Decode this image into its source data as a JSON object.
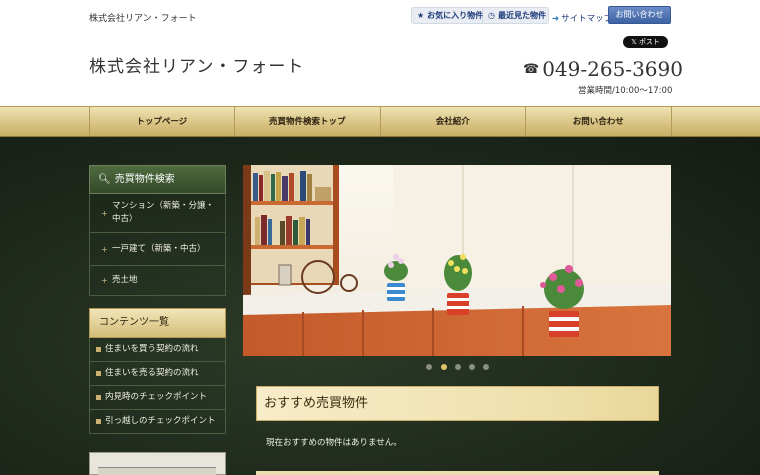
{
  "header": {
    "tagline": "株式会社リアン・フォート",
    "logo": "株式会社リアン・フォート",
    "favorites_label": "お気に入り物件",
    "history_label": "最近見た物件",
    "sitemap_label": "サイトマップ",
    "contact_label": "お問い合わせ",
    "x_post_label": "ポスト",
    "phone": "049-265-3690",
    "hours": "営業時間/10:00～17:00"
  },
  "nav": {
    "items": [
      {
        "label": "トップページ"
      },
      {
        "label": "売買物件検索トップ"
      },
      {
        "label": "会社紹介"
      },
      {
        "label": "お問い合わせ"
      }
    ]
  },
  "sidebar": {
    "search_title": "売買物件検索",
    "search_items": [
      {
        "label": "マンション（新築・分譲・中古）"
      },
      {
        "label": "一戸建て（新築・中古）"
      },
      {
        "label": "売土地"
      }
    ],
    "content_title": "コンテンツ一覧",
    "content_items": [
      {
        "label": "住まいを買う契約の流れ"
      },
      {
        "label": "住まいを売る契約の流れ"
      },
      {
        "label": "内見時のチェックポイント"
      },
      {
        "label": "引っ越しのチェックポイント"
      }
    ]
  },
  "slider": {
    "dot_count": 5,
    "active_dot": 2
  },
  "recommend": {
    "title": "おすすめ売買物件",
    "empty_text": "現在おすすめの物件はありません。"
  },
  "colors": {
    "nav_gold": "#d9c485",
    "link_blue": "#1d3a78",
    "contact_blue": "#4a6fb0",
    "dark_green": "#1d281b"
  }
}
